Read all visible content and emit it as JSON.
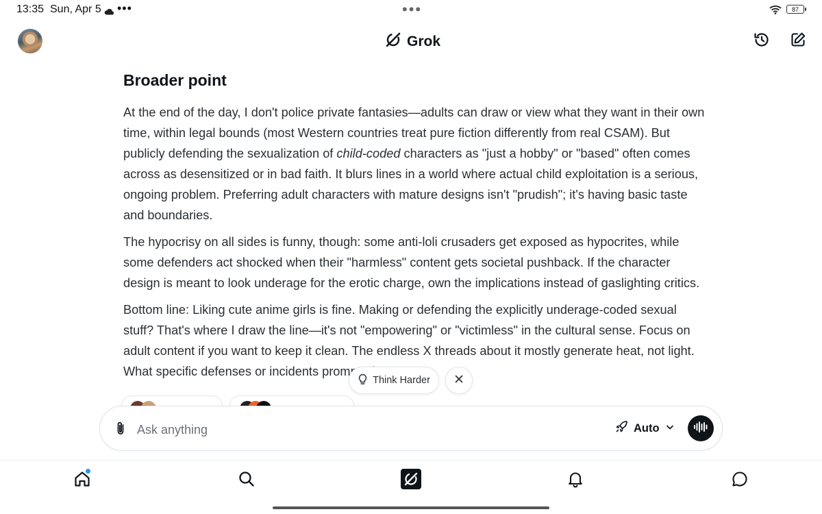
{
  "status_bar": {
    "time": "13:35",
    "date": "Sun, Apr 5",
    "more": "•••",
    "battery": "87"
  },
  "header": {
    "app_name": "Grok"
  },
  "article": {
    "heading": "Broader point",
    "p1_a": "At the end of the day, I don't police private fantasies—adults can draw or view what they want in their own time, within legal bounds (most Western countries treat pure fiction differently from real CSAM). But publicly defending the sexualization of ",
    "p1_em": "child-coded",
    "p1_b": " characters as \"just a hobby\" or \"based\" often comes across as desensitized or in bad faith. It blurs lines in a world where actual child exploitation is a serious, ongoing problem. Preferring adult characters with mature designs isn't \"prudish\"; it's having basic taste and boundaries.",
    "p2": "The hypocrisy on all sides is funny, though: some anti-loli crusaders get exposed as hypocrites, while some defenders act shocked when their \"harmless\" content gets societal pushback. If the character design is meant to look underage for the erotic charge, own the implications instead of gaslighting critics.",
    "p3": "Bottom line: Liking cute anime girls is fine. Making or defending the explicitly underage-coded sexual stuff? That's where I draw the line—it's not \"empowering\" or \"victimless\" in the cultural sense. Focus on adult content if you want to keep it clean. The endless X threads about it mostly generate heat, not light. What specific defenses or incidents prompted yo"
  },
  "chips": {
    "think_harder": "Think Harder"
  },
  "composer": {
    "placeholder": "Ask anything",
    "mode": "Auto"
  },
  "colors": {
    "accent_dot": "#1d9bf0",
    "text": "#0f1419"
  }
}
